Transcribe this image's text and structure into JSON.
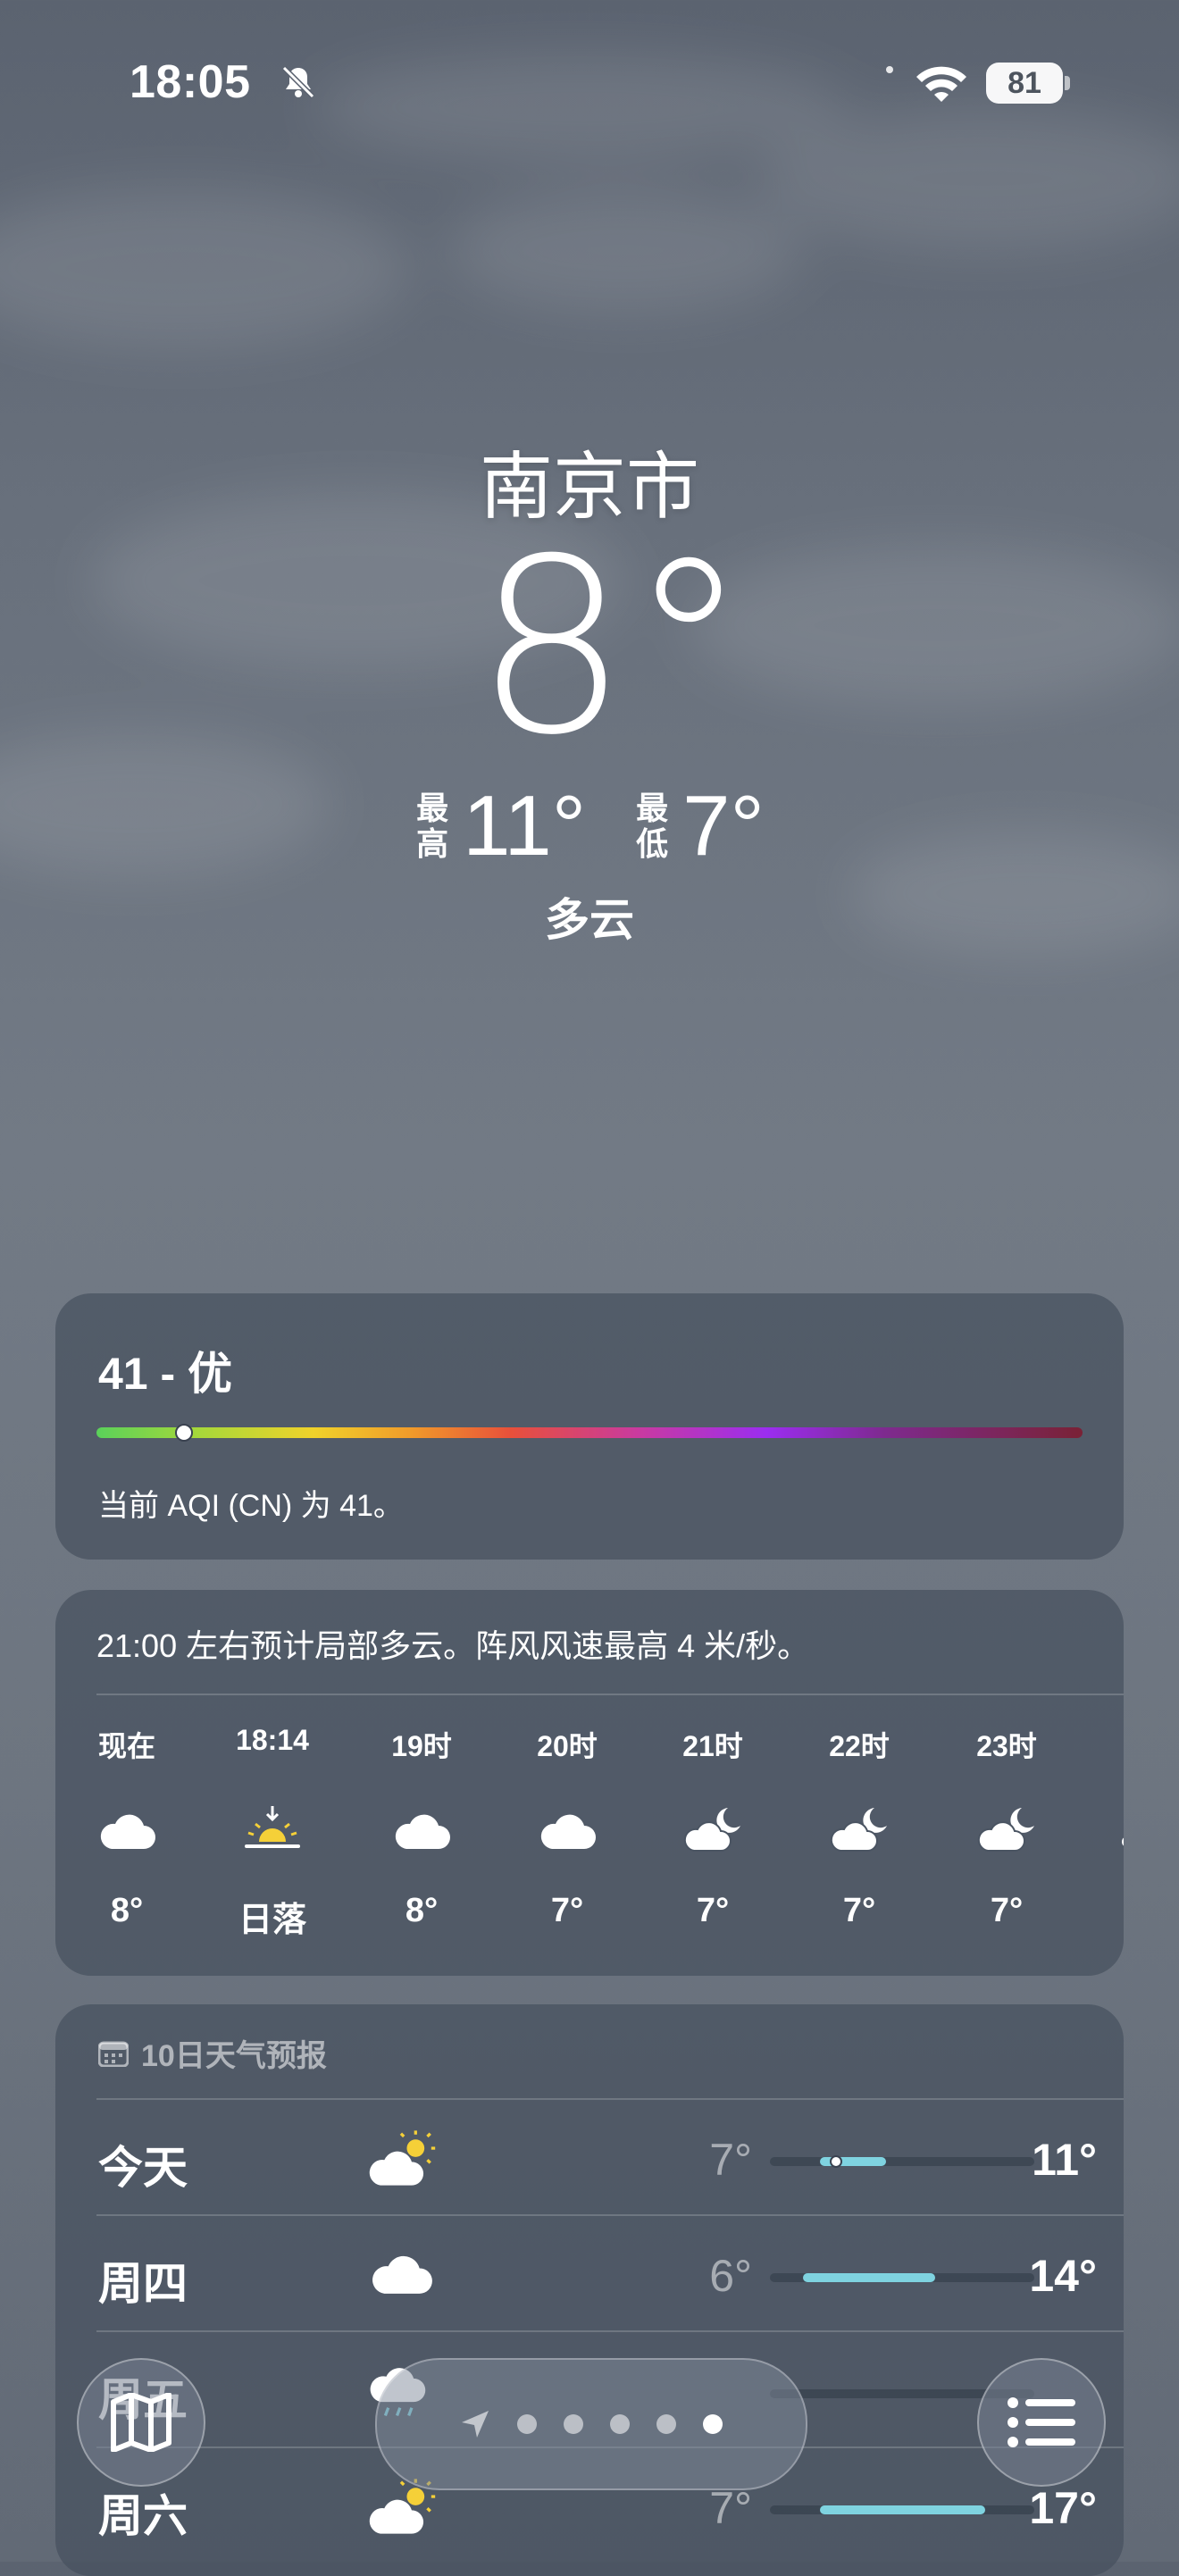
{
  "status_bar": {
    "time": "18:05",
    "battery": "81"
  },
  "hero": {
    "city": "南京市",
    "temperature": "8°",
    "high_label": "最高",
    "high": "11°",
    "low_label": "最低",
    "low": "7°",
    "condition": "多云"
  },
  "aqi": {
    "value_text": "41 - 优",
    "description": "当前 AQI (CN) 为 41。",
    "index": 41,
    "bar_position": 0.085
  },
  "hourly": {
    "summary": "21:00 左右预计局部多云。阵风风速最高 4 米/秒。",
    "items": [
      {
        "label": "现在",
        "icon": "cloud-icon",
        "temp": "8°"
      },
      {
        "label": "18:14",
        "icon": "sunset-icon",
        "temp": "日落"
      },
      {
        "label": "19时",
        "icon": "cloud-icon",
        "temp": "8°"
      },
      {
        "label": "20时",
        "icon": "cloud-icon",
        "temp": "7°"
      },
      {
        "label": "21时",
        "icon": "cloud-moon-icon",
        "temp": "7°"
      },
      {
        "label": "22时",
        "icon": "cloud-moon-icon",
        "temp": "7°"
      },
      {
        "label": "23时",
        "icon": "cloud-moon-icon",
        "temp": "7°"
      }
    ]
  },
  "forecast": {
    "title": "10日天气预报",
    "days": [
      {
        "day": "今天",
        "icon": "partly-sunny-icon",
        "low": "7°",
        "high": "11°"
      },
      {
        "day": "周四",
        "icon": "cloud-icon",
        "low": "6°",
        "high": "14°"
      },
      {
        "day": "周五",
        "icon": "rain-cloud-icon",
        "low": "",
        "high": ""
      },
      {
        "day": "周六",
        "icon": "partly-sunny-icon",
        "low": "7°",
        "high": "17°"
      }
    ]
  },
  "bottom_bar": {
    "map_icon": "map-icon",
    "list_icon": "list-icon",
    "location_icon": "location-arrow-icon",
    "page_count": 6,
    "active_page": 6
  },
  "colors": {
    "card": "#46505e",
    "aqi_good": "#5ad15a",
    "temp_bar": "#7fd3e0",
    "sun": "#f5d038"
  }
}
